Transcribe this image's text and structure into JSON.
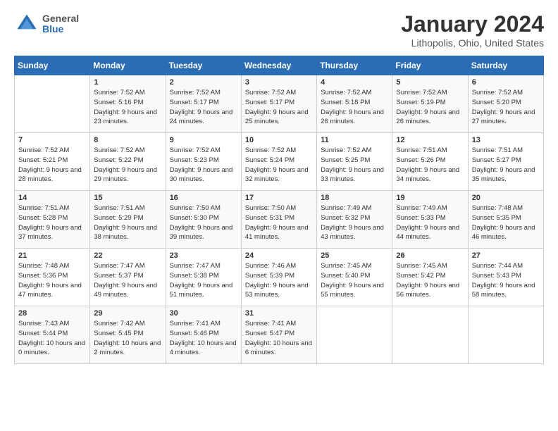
{
  "header": {
    "logo": {
      "general": "General",
      "blue": "Blue"
    },
    "title": "January 2024",
    "location": "Lithopolis, Ohio, United States"
  },
  "weekdays": [
    "Sunday",
    "Monday",
    "Tuesday",
    "Wednesday",
    "Thursday",
    "Friday",
    "Saturday"
  ],
  "weeks": [
    [
      {
        "day": null
      },
      {
        "day": 1,
        "sunrise": "7:52 AM",
        "sunset": "5:16 PM",
        "daylight": "9 hours and 23 minutes."
      },
      {
        "day": 2,
        "sunrise": "7:52 AM",
        "sunset": "5:17 PM",
        "daylight": "9 hours and 24 minutes."
      },
      {
        "day": 3,
        "sunrise": "7:52 AM",
        "sunset": "5:17 PM",
        "daylight": "9 hours and 25 minutes."
      },
      {
        "day": 4,
        "sunrise": "7:52 AM",
        "sunset": "5:18 PM",
        "daylight": "9 hours and 26 minutes."
      },
      {
        "day": 5,
        "sunrise": "7:52 AM",
        "sunset": "5:19 PM",
        "daylight": "9 hours and 26 minutes."
      },
      {
        "day": 6,
        "sunrise": "7:52 AM",
        "sunset": "5:20 PM",
        "daylight": "9 hours and 27 minutes."
      }
    ],
    [
      {
        "day": 7,
        "sunrise": "7:52 AM",
        "sunset": "5:21 PM",
        "daylight": "9 hours and 28 minutes."
      },
      {
        "day": 8,
        "sunrise": "7:52 AM",
        "sunset": "5:22 PM",
        "daylight": "9 hours and 29 minutes."
      },
      {
        "day": 9,
        "sunrise": "7:52 AM",
        "sunset": "5:23 PM",
        "daylight": "9 hours and 30 minutes."
      },
      {
        "day": 10,
        "sunrise": "7:52 AM",
        "sunset": "5:24 PM",
        "daylight": "9 hours and 32 minutes."
      },
      {
        "day": 11,
        "sunrise": "7:52 AM",
        "sunset": "5:25 PM",
        "daylight": "9 hours and 33 minutes."
      },
      {
        "day": 12,
        "sunrise": "7:51 AM",
        "sunset": "5:26 PM",
        "daylight": "9 hours and 34 minutes."
      },
      {
        "day": 13,
        "sunrise": "7:51 AM",
        "sunset": "5:27 PM",
        "daylight": "9 hours and 35 minutes."
      }
    ],
    [
      {
        "day": 14,
        "sunrise": "7:51 AM",
        "sunset": "5:28 PM",
        "daylight": "9 hours and 37 minutes."
      },
      {
        "day": 15,
        "sunrise": "7:51 AM",
        "sunset": "5:29 PM",
        "daylight": "9 hours and 38 minutes."
      },
      {
        "day": 16,
        "sunrise": "7:50 AM",
        "sunset": "5:30 PM",
        "daylight": "9 hours and 39 minutes."
      },
      {
        "day": 17,
        "sunrise": "7:50 AM",
        "sunset": "5:31 PM",
        "daylight": "9 hours and 41 minutes."
      },
      {
        "day": 18,
        "sunrise": "7:49 AM",
        "sunset": "5:32 PM",
        "daylight": "9 hours and 43 minutes."
      },
      {
        "day": 19,
        "sunrise": "7:49 AM",
        "sunset": "5:33 PM",
        "daylight": "9 hours and 44 minutes."
      },
      {
        "day": 20,
        "sunrise": "7:48 AM",
        "sunset": "5:35 PM",
        "daylight": "9 hours and 46 minutes."
      }
    ],
    [
      {
        "day": 21,
        "sunrise": "7:48 AM",
        "sunset": "5:36 PM",
        "daylight": "9 hours and 47 minutes."
      },
      {
        "day": 22,
        "sunrise": "7:47 AM",
        "sunset": "5:37 PM",
        "daylight": "9 hours and 49 minutes."
      },
      {
        "day": 23,
        "sunrise": "7:47 AM",
        "sunset": "5:38 PM",
        "daylight": "9 hours and 51 minutes."
      },
      {
        "day": 24,
        "sunrise": "7:46 AM",
        "sunset": "5:39 PM",
        "daylight": "9 hours and 53 minutes."
      },
      {
        "day": 25,
        "sunrise": "7:45 AM",
        "sunset": "5:40 PM",
        "daylight": "9 hours and 55 minutes."
      },
      {
        "day": 26,
        "sunrise": "7:45 AM",
        "sunset": "5:42 PM",
        "daylight": "9 hours and 56 minutes."
      },
      {
        "day": 27,
        "sunrise": "7:44 AM",
        "sunset": "5:43 PM",
        "daylight": "9 hours and 58 minutes."
      }
    ],
    [
      {
        "day": 28,
        "sunrise": "7:43 AM",
        "sunset": "5:44 PM",
        "daylight": "10 hours and 0 minutes."
      },
      {
        "day": 29,
        "sunrise": "7:42 AM",
        "sunset": "5:45 PM",
        "daylight": "10 hours and 2 minutes."
      },
      {
        "day": 30,
        "sunrise": "7:41 AM",
        "sunset": "5:46 PM",
        "daylight": "10 hours and 4 minutes."
      },
      {
        "day": 31,
        "sunrise": "7:41 AM",
        "sunset": "5:47 PM",
        "daylight": "10 hours and 6 minutes."
      },
      {
        "day": null
      },
      {
        "day": null
      },
      {
        "day": null
      }
    ]
  ]
}
